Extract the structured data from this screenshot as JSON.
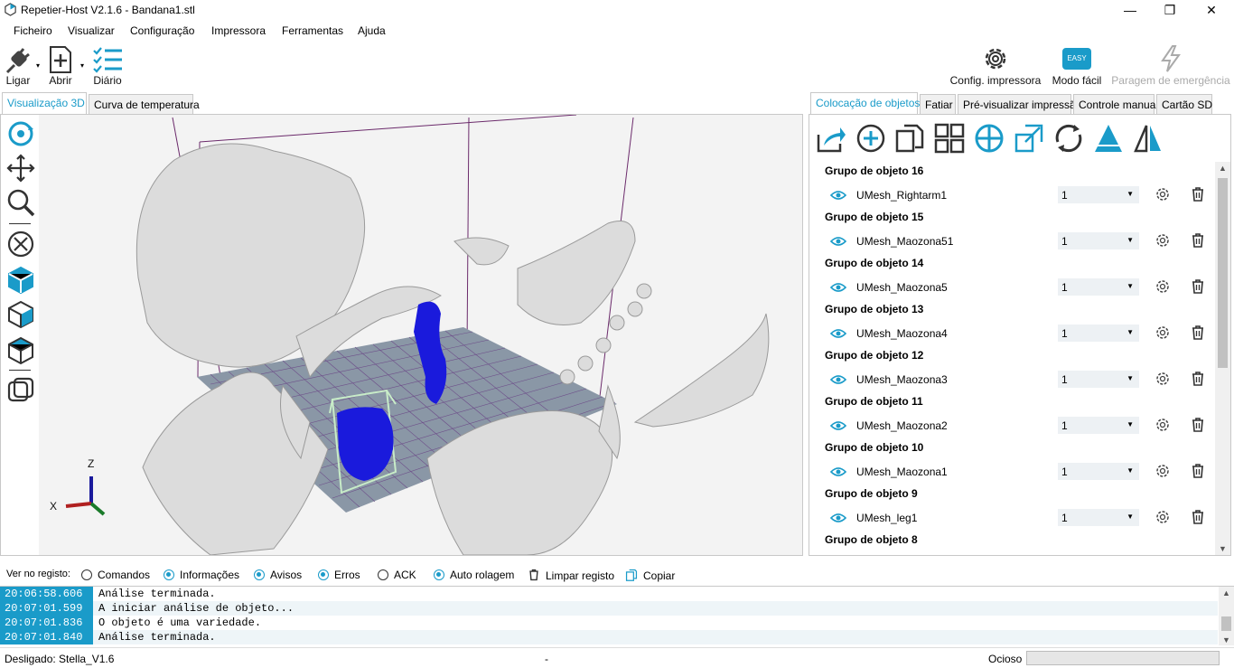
{
  "window": {
    "title": "Repetier-Host V2.1.6 - Bandana1.stl",
    "minimize": "—",
    "maximize": "❐",
    "close": "✕"
  },
  "menu": [
    "Ficheiro",
    "Visualizar",
    "Configuração",
    "Impressora",
    "Ferramentas",
    "Ajuda"
  ],
  "toolbar": {
    "connect": "Ligar",
    "open": "Abrir",
    "log": "Diário",
    "printer_config": "Config. impressora",
    "easy_mode": "Modo fácil",
    "easy_badge": "EASY",
    "emergency": "Paragem de emergência"
  },
  "left_tabs": [
    "Visualização 3D",
    "Curva de temperatura"
  ],
  "right_tabs": [
    "Colocação de objetos",
    "Fatiar",
    "Pré-visualizar impressão",
    "Controle manual",
    "Cartão SD"
  ],
  "axes": {
    "z": "Z",
    "x": "X"
  },
  "object_groups": [
    {
      "group": "Grupo de objeto 16",
      "name": "UMesh_Rightarm1",
      "copies": "1"
    },
    {
      "group": "Grupo de objeto 15",
      "name": "UMesh_Maozona51",
      "copies": "1"
    },
    {
      "group": "Grupo de objeto 14",
      "name": "UMesh_Maozona5",
      "copies": "1"
    },
    {
      "group": "Grupo de objeto 13",
      "name": "UMesh_Maozona4",
      "copies": "1"
    },
    {
      "group": "Grupo de objeto 12",
      "name": "UMesh_Maozona3",
      "copies": "1"
    },
    {
      "group": "Grupo de objeto 11",
      "name": "UMesh_Maozona2",
      "copies": "1"
    },
    {
      "group": "Grupo de objeto 10",
      "name": "UMesh_Maozona1",
      "copies": "1"
    },
    {
      "group": "Grupo de objeto 9",
      "name": "UMesh_leg1",
      "copies": "1"
    },
    {
      "group": "Grupo de objeto 8",
      "name": "",
      "copies": ""
    }
  ],
  "logbar": {
    "label": "Ver no registo:",
    "options": [
      {
        "label": "Comandos",
        "checked": false
      },
      {
        "label": "Informações",
        "checked": true
      },
      {
        "label": "Avisos",
        "checked": true
      },
      {
        "label": "Erros",
        "checked": true
      },
      {
        "label": "ACK",
        "checked": false
      },
      {
        "label": "Auto rolagem",
        "checked": true
      }
    ],
    "clear": "Limpar registo",
    "copy": "Copiar"
  },
  "log": [
    {
      "time": "20:06:58.606",
      "msg": "Análise terminada."
    },
    {
      "time": "20:07:01.599",
      "msg": "A iniciar análise de objeto..."
    },
    {
      "time": "20:07:01.836",
      "msg": "O objeto é uma variedade."
    },
    {
      "time": "20:07:01.840",
      "msg": "Análise terminada."
    }
  ],
  "status": {
    "connection": "Desligado: Stella_V1.6",
    "middle": "-",
    "state": "Ocioso"
  },
  "colors": {
    "accent": "#1a9bc9",
    "selected_object": "#1a1adc",
    "bed": "#8a97a6"
  }
}
